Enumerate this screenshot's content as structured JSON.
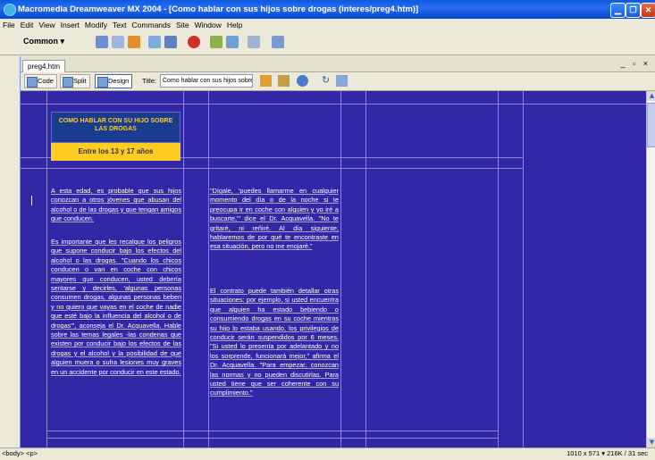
{
  "window": {
    "title": "Macromedia Dreamweaver MX 2004 - [Como hablar con sus hijos sobre drogas (interes/preg4.htm)]"
  },
  "menu": [
    "File",
    "Edit",
    "View",
    "Insert",
    "Modify",
    "Text",
    "Commands",
    "Site",
    "Window",
    "Help"
  ],
  "insert_bar": {
    "category": "Common ▾"
  },
  "document": {
    "tab": "preg4.htm",
    "views": {
      "code": "Code",
      "split": "Split",
      "design": "Design"
    },
    "title_label": "Title:",
    "title_value": "Como hablar con sus hijos sobre drogas"
  },
  "page": {
    "heading": "COMO HABLAR CON SU HIJO SOBRE LAS DROGAS",
    "age_band": "Entre los 13 y 17 años",
    "col1": [
      "A esta edad, es probable que sus hijos conozcan a otros jóvenes que abusan del alcohol o de las drogas y que tengan amigos que conducen.",
      "Es importante que les recalque los peligros que supone conducir bajo los efectos del alcohol o las drogas. \"Cuando los chicos conducen o van en coche con chicos mayores que conducen, usted debería sentarse y decirles, 'algunas personas consumen drogas, algunas personas beben y no quiero que vayas en el coche de nadie que esté bajo la influencia del alcohol o de drogas'\", aconseja el Dr. Acquavella. Hable sobre las temas legales -las condenas que existen por conducir bajo los efectos de las drogas y el alcohol y la posibilidad de que alguien muera o sufra lesiones muy graves en un accidente por conducir en este estado."
    ],
    "col2": [
      "\"Dígale, 'puedes llamarme en cualquier momento del día o de la noche si te preocupa ir en coche con alguien y yo iré a buscarte,'\" dice el Dr. Acquavella. \"No te gritaré, ni reñiré. Al día siguiente, hablaremos de por qué te encontraste en esa situación, pero no me enojaré.\"",
      "El contrato puede también detallar otras situaciones: por ejemplo, si usted encuentra que alguien ha estado bebiendo o consumiendo drogas en su coche mientras su hijo lo estaba usando, los privilegios de conducir serán suspendidos por 6 meses. \"Si usted lo presenta por adelantado y no los sorprende, funcionará mejor,\" afirma el Dr. Acquavella. \"Para empezar, conozcan las normas y no pueden discutirlas. Para usted tiene que ser coherente con su cumplimiento.\""
    ]
  },
  "status": {
    "tag_selector": "<body> <p>",
    "doc_info": "1010 x 571 ▾ 216K / 31 sec"
  },
  "colors": {
    "page_bg": "#3227a6",
    "heading_bg": "#1a3c8f",
    "accent": "#ffcc22"
  }
}
